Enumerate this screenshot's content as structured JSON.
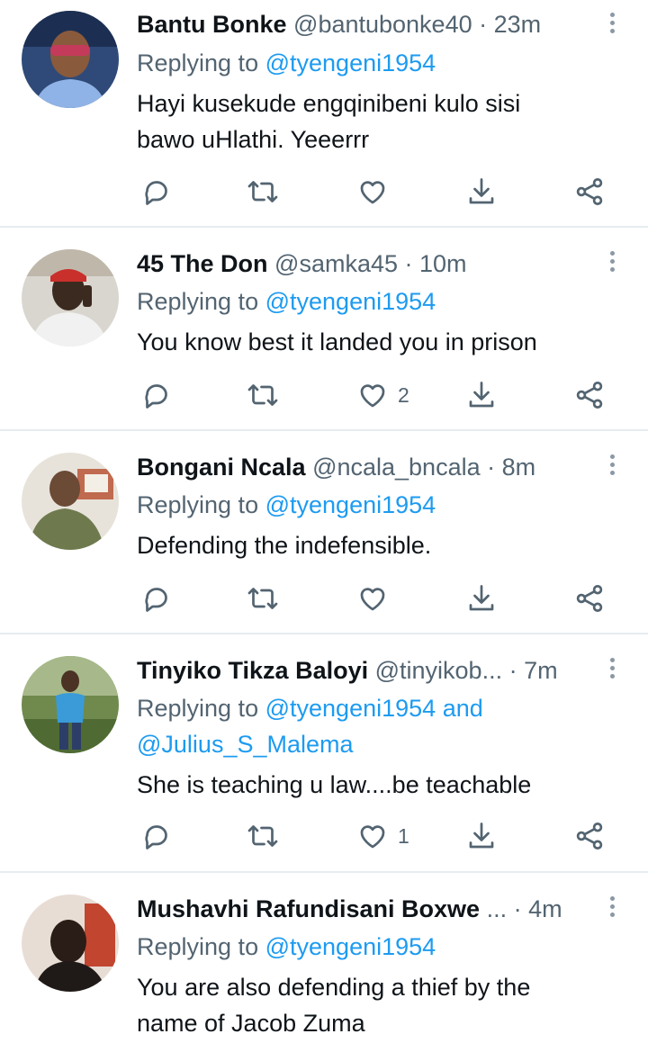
{
  "replies": [
    {
      "name": "Bantu Bonke",
      "handle": "@bantubonke40",
      "time": "· 23m",
      "replying_prefix": "Replying to",
      "replying_to": "@tyengeni1954",
      "replying_suffix": "",
      "replying_to_2": "",
      "text_line_1": "Hayi kusekude engqinibeni kulo sisi",
      "text_line_2": "bawo uHlathi. Yeeerrr",
      "like_count": ""
    },
    {
      "name": "45 The Don",
      "handle": "@samka45",
      "time": "· 10m",
      "replying_prefix": "Replying to",
      "replying_to": "@tyengeni1954",
      "replying_suffix": "",
      "replying_to_2": "",
      "text_line_1": "You know best it landed you in prison",
      "text_line_2": "",
      "like_count": "2"
    },
    {
      "name": "Bongani Ncala",
      "handle": "@ncala_bncala",
      "time": "· 8m",
      "replying_prefix": "Replying to",
      "replying_to": "@tyengeni1954",
      "replying_suffix": "",
      "replying_to_2": "",
      "text_line_1": "Defending the indefensible.",
      "text_line_2": "",
      "like_count": ""
    },
    {
      "name": "Tinyiko Tikza Baloyi",
      "handle": "@tinyikob...",
      "time": "· 7m",
      "replying_prefix": "Replying to",
      "replying_to": "@tyengeni1954",
      "replying_suffix": "and",
      "replying_to_2": "@Julius_S_Malema",
      "text_line_1": "She is teaching u law....be teachable",
      "text_line_2": "",
      "like_count": "1"
    },
    {
      "name": "Mushavhi Rafundisani Boxwe",
      "handle": "...",
      "time": "· 4m",
      "replying_prefix": "Replying to",
      "replying_to": "@tyengeni1954",
      "replying_suffix": "",
      "replying_to_2": "",
      "text_line_1": "You are also defending a thief by the",
      "text_line_2": "name of Jacob Zuma",
      "like_count": ""
    }
  ],
  "icons": {
    "reply": "reply-icon",
    "retweet": "retweet-icon",
    "like": "heart-icon",
    "download": "download-icon",
    "share": "share-icon",
    "more": "more-vertical-icon"
  },
  "colors": {
    "link": "#1d9bf0",
    "secondary_text": "#536471",
    "primary_text": "#0f1419",
    "divider": "#e6ecf0"
  }
}
